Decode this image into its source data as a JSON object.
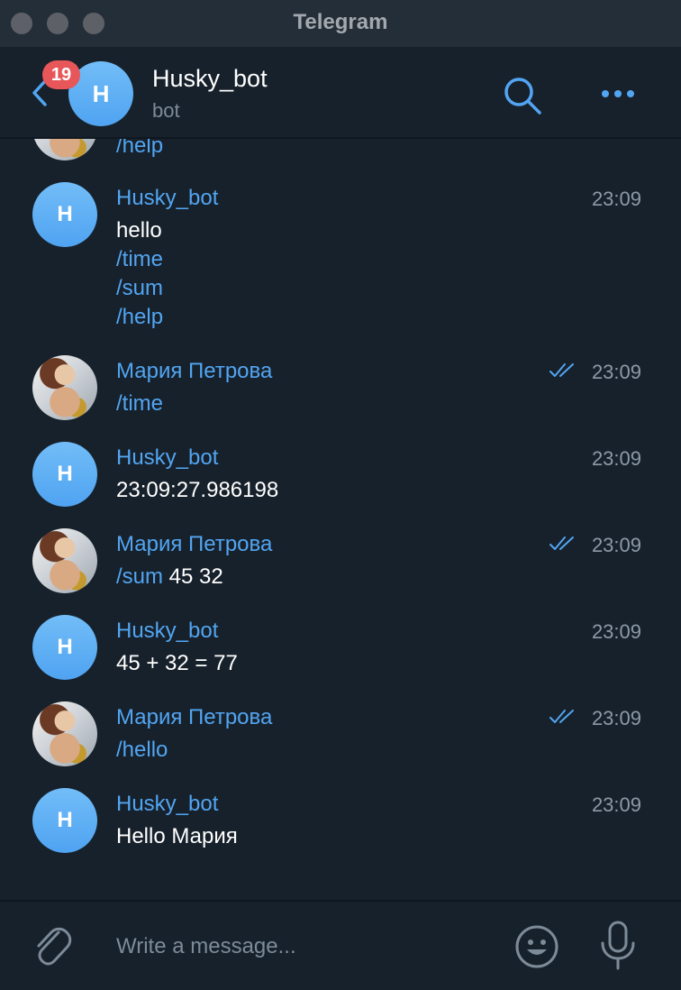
{
  "window": {
    "title": "Telegram"
  },
  "header": {
    "unread_count": "19",
    "avatar_letter": "H",
    "chat_name": "Husky_bot",
    "chat_status": "bot"
  },
  "messages": [
    {
      "type": "partial",
      "lines": [
        "/help"
      ]
    },
    {
      "sender": "Husky_bot",
      "avatar": "H",
      "time": "23:09",
      "lines": [
        "hello",
        "/time",
        "/sum",
        "/help"
      ]
    },
    {
      "sender": "Мария Петрова",
      "time": "23:09",
      "text_cmd": "/time"
    },
    {
      "sender": "Husky_bot",
      "avatar": "H",
      "time": "23:09",
      "text": "23:09:27.986198"
    },
    {
      "sender": "Мария Петрова",
      "time": "23:09",
      "text_cmd": "/sum",
      "text_rest": " 45 32"
    },
    {
      "sender": "Husky_bot",
      "avatar": "H",
      "time": "23:09",
      "text": "45 + 32 = 77"
    },
    {
      "sender": "Мария Петрова",
      "time": "23:09",
      "text_cmd": "/hello"
    },
    {
      "sender": "Husky_bot",
      "avatar": "H",
      "time": "23:09",
      "text": "Hello Мария"
    }
  ],
  "composer": {
    "placeholder": "Write a message..."
  },
  "colors": {
    "background": "#17212b",
    "accent": "#52a5f2",
    "badge": "#e7575a",
    "muted": "#8d9aa6"
  },
  "icons": [
    "back-chevron-icon",
    "search-icon",
    "more-icon",
    "paperclip-icon",
    "emoji-icon",
    "microphone-icon",
    "double-check-icon"
  ]
}
